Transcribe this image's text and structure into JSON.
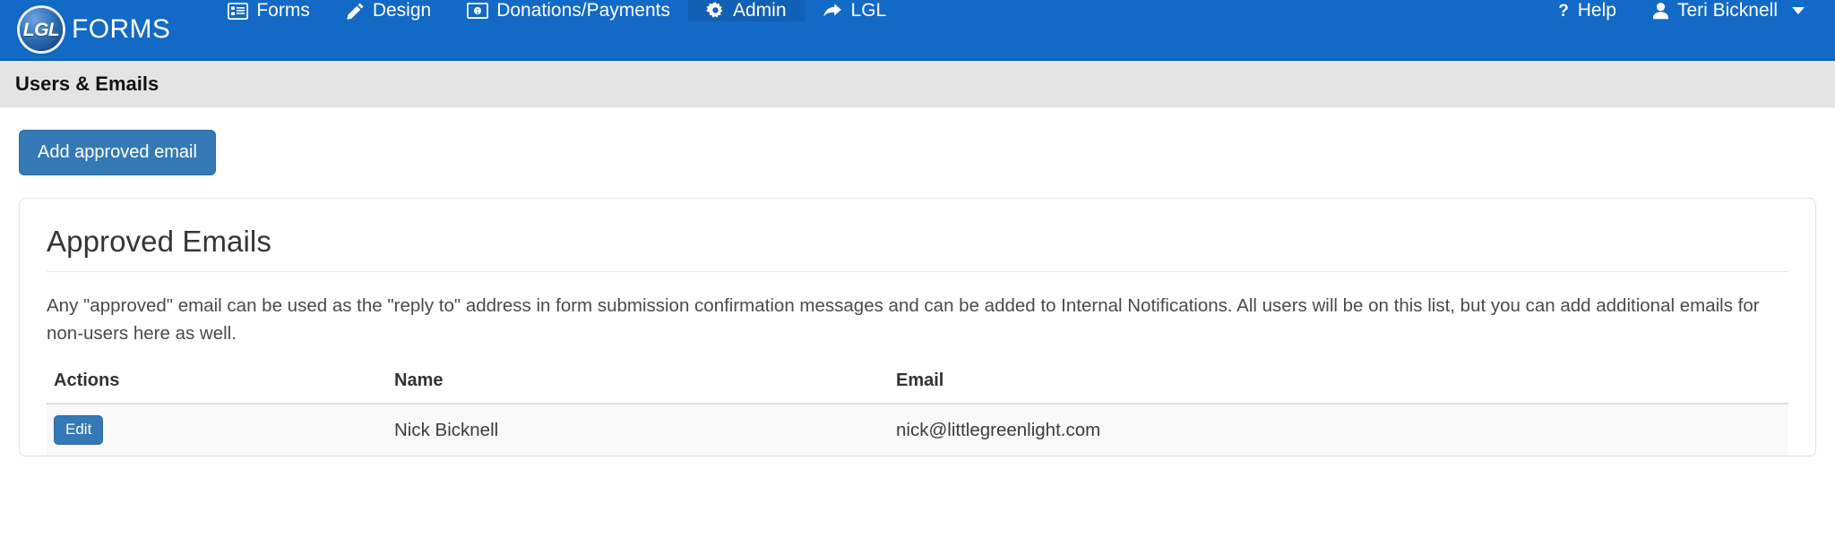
{
  "navbar": {
    "brand": {
      "badge_text": "LGL",
      "word": "FORMS",
      "logo_icon": "lgl-circle-logo"
    },
    "items": [
      {
        "label": "Forms",
        "icon": "list-alt-icon",
        "active": false
      },
      {
        "label": "Design",
        "icon": "pencil-icon",
        "active": false
      },
      {
        "label": "Donations/Payments",
        "icon": "money-bill-icon",
        "active": false
      },
      {
        "label": "Admin",
        "icon": "gear-icon",
        "active": true
      },
      {
        "label": "LGL",
        "icon": "share-arrow-icon",
        "active": false
      }
    ],
    "help": {
      "label": "Help",
      "icon": "question-mark-icon"
    },
    "user": {
      "label": "Teri Bicknell",
      "icon": "user-icon",
      "caret": "chevron-down-icon"
    },
    "background_color": "#1269c6",
    "active_color": "#1160b3"
  },
  "page": {
    "title": "Users & Emails",
    "title_bar_color": "#e4e4e4"
  },
  "toolbar": {
    "add_email_label": "Add approved email",
    "primary_color": "#3479b5"
  },
  "card": {
    "title": "Approved Emails",
    "description": "Any \"approved\" email can be used as the \"reply to\" address in form submission confirmation messages and can be added to Internal Notifications. All users will be on this list, but you can add additional emails for non-users here as well."
  },
  "table": {
    "columns": [
      "Actions",
      "Name",
      "Email"
    ],
    "rows": [
      {
        "action_label": "Edit",
        "name": "Nick Bicknell",
        "email": "nick@littlegreenlight.com"
      }
    ]
  }
}
